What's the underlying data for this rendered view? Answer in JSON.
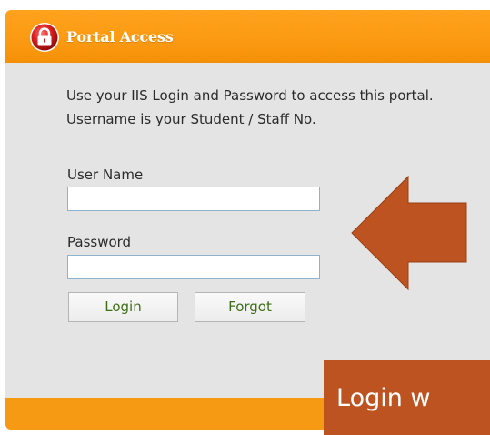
{
  "header": {
    "title": "Portal Access",
    "icon": "lock-icon",
    "color": "#f7950e"
  },
  "intro_text": "Use your IIS Login and Password to access this portal. Username is your Student / Staff No.",
  "form": {
    "username_label": "User Name",
    "username_value": "",
    "password_label": "Password",
    "password_value": "",
    "login_button": "Login",
    "forgot_button": "Forgot"
  },
  "annotation": {
    "arrow_icon": "left-arrow-icon",
    "arrow_color": "#bd5320",
    "callout_text": "Login w"
  }
}
